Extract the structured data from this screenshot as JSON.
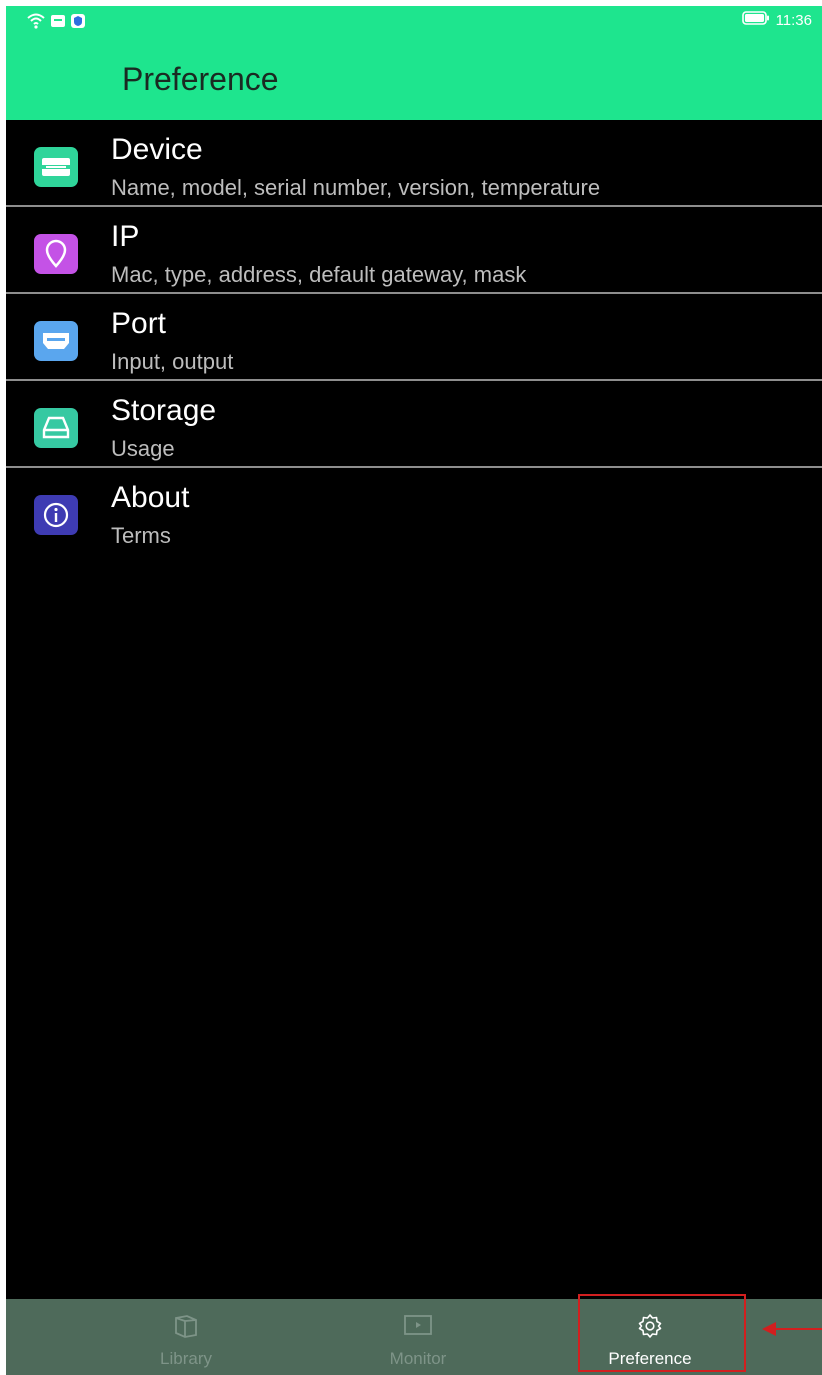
{
  "status_bar": {
    "time": "11:36",
    "icons": [
      "wifi-icon",
      "sim-icon",
      "shield-icon",
      "battery-icon"
    ]
  },
  "app_bar": {
    "title": "Preference"
  },
  "menu": [
    {
      "title": "Device",
      "subtitle": "Name, model, serial number, version, temperature",
      "icon": "device-icon",
      "color": "#2fd59a"
    },
    {
      "title": "IP",
      "subtitle": "Mac, type, address, default gateway, mask",
      "icon": "location-pin-icon",
      "color": "#c452e6"
    },
    {
      "title": "Port",
      "subtitle": "Input, output",
      "icon": "port-icon",
      "color": "#5aa6ee"
    },
    {
      "title": "Storage",
      "subtitle": "Usage",
      "icon": "storage-icon",
      "color": "#36c9a2"
    },
    {
      "title": "About",
      "subtitle": "Terms",
      "icon": "info-icon",
      "color": "#3e3bb3"
    }
  ],
  "tab_bar": {
    "tabs": [
      {
        "label": "Library",
        "icon": "library-icon",
        "active": false
      },
      {
        "label": "Monitor",
        "icon": "monitor-icon",
        "active": false
      },
      {
        "label": "Preference",
        "icon": "gear-icon",
        "active": true
      }
    ]
  },
  "colors": {
    "accent": "#1ee58e",
    "background": "#000000",
    "tab_bar": "#4e6a5a",
    "annotation": "#d21f1f"
  }
}
